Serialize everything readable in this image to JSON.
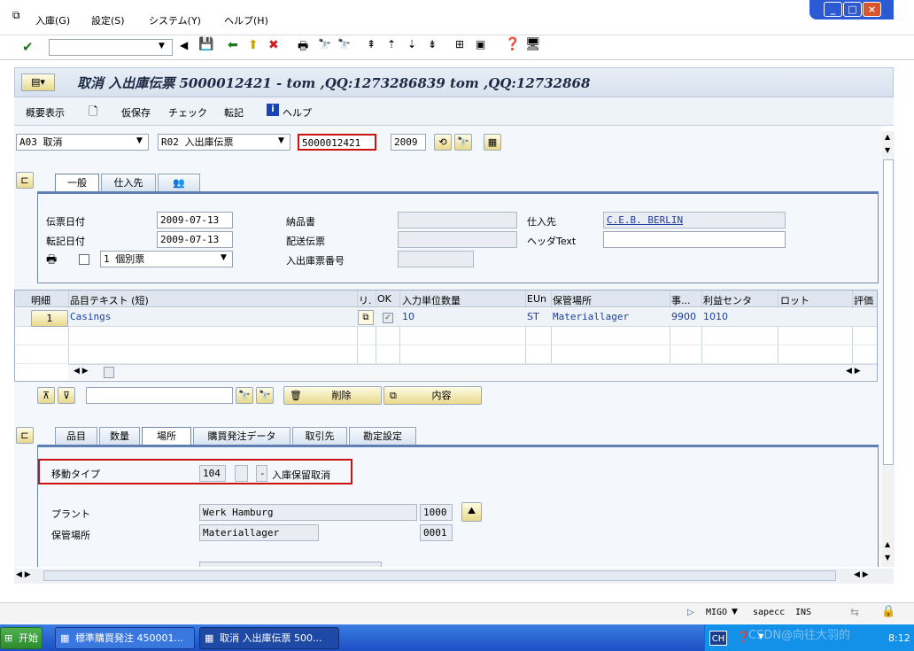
{
  "menubar": {
    "items": [
      "入庫(G)",
      "設定(S)",
      "システム(Y)",
      "ヘルプ(H)"
    ],
    "window_controls": [
      "_",
      "□",
      "×"
    ]
  },
  "toolbar": {
    "command_field": "",
    "icons": [
      "ok-icon",
      "back-icon",
      "save-icon",
      "nav-back-icon",
      "exit-icon",
      "cancel-icon",
      "print-icon",
      "find-icon",
      "find-next-icon",
      "first-page-icon",
      "prev-page-icon",
      "next-page-icon",
      "last-page-icon",
      "layout-icon",
      "create-session-icon",
      "help-icon",
      "settings-icon"
    ]
  },
  "title": {
    "text": "取消 入出庫伝票 5000012421 - tom ,QQ:1273286839 tom ,QQ:12732868"
  },
  "app_toolbar": {
    "overview": "概要表示",
    "hold": "仮保存",
    "check": "チェック",
    "post": "転記",
    "help": "ヘルプ"
  },
  "header": {
    "action_select": "A03 取消",
    "ref_select": "R02 入出庫伝票",
    "doc_number": "5000012421",
    "year": "2009"
  },
  "tabs_top": {
    "general": "一般",
    "vendor": "仕入先"
  },
  "general": {
    "doc_date_label": "伝票日付",
    "doc_date": "2009-07-13",
    "post_date_label": "転記日付",
    "post_date": "2009-07-13",
    "slip_select": "1 個別票",
    "delivery_note_label": "納品書",
    "bill_of_lading_label": "配送伝票",
    "gr_slip_label": "入出庫票番号",
    "vendor_label": "仕入先",
    "vendor_value": "C.E.B. BERLIN",
    "header_text_label": "ヘッダText"
  },
  "grid": {
    "headers": [
      "明細",
      "品目テキスト (短)",
      "リ.",
      "OK",
      "入力単位数量",
      "EUn",
      "保管場所",
      "事...",
      "利益センタ",
      "ロット",
      "評価"
    ],
    "row": {
      "line": "1",
      "material": "Casings",
      "qty": "10",
      "unit": "ST",
      "sloc": "Materiallager",
      "plant": "9900",
      "profit_center": "1010"
    }
  },
  "grid_toolbar": {
    "delete": "削除",
    "content": "内容"
  },
  "tabs_bottom": [
    "品目",
    "数量",
    "場所",
    "購買発注データ",
    "取引先",
    "勘定設定"
  ],
  "location": {
    "movement_type_label": "移動タイプ",
    "movement_type": "104",
    "movement_sign": "-",
    "movement_text": "入庫保留取消",
    "plant_label": "プラント",
    "plant_name": "Werk Hamburg",
    "plant_code": "1000",
    "sloc_label": "保管場所",
    "sloc_name": "Materiallager",
    "sloc_code": "0001"
  },
  "statusbar": {
    "tcode": "MIGO",
    "system": "sapecc",
    "mode": "INS"
  },
  "taskbar": {
    "start": "开始",
    "task1": "標準購買発注 450001...",
    "task2": "取消 入出庫伝票 500...",
    "lang": "CH",
    "time": "8:12",
    "watermark": "CSDN@向往大羽的"
  },
  "colors": {
    "accent": "#cc1111",
    "tab_blue": "#5d7fb4",
    "taskbar": "#2b63d6"
  }
}
